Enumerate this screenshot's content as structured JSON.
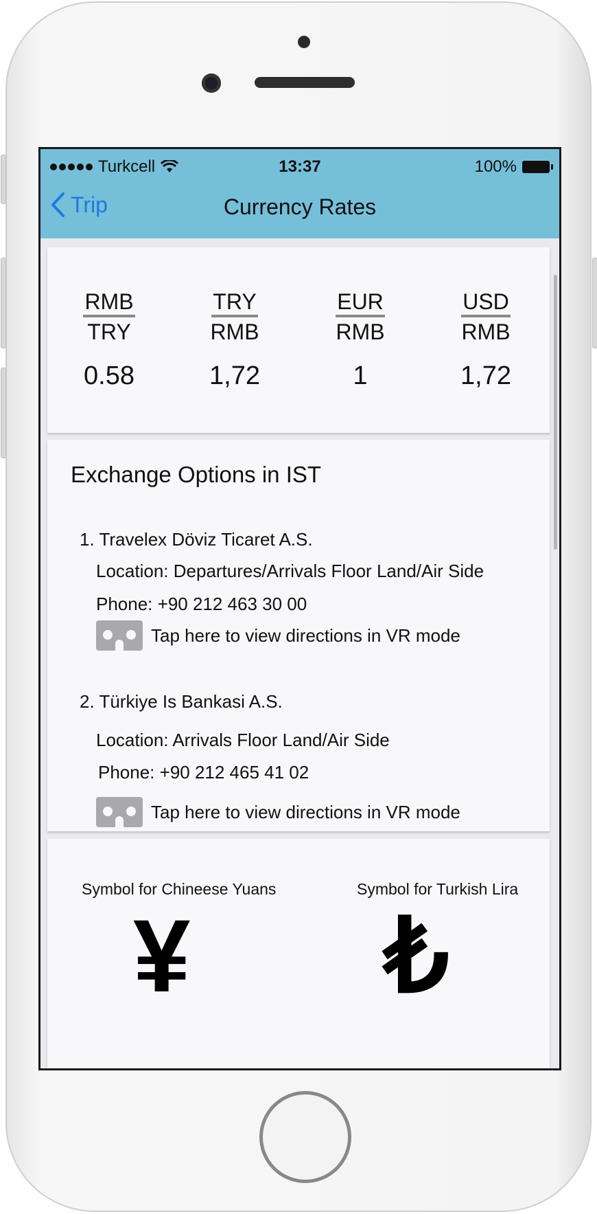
{
  "status": {
    "carrier": "Turkcell",
    "time": "13:37",
    "battery": "100%"
  },
  "nav": {
    "back_label": "Trip",
    "title": "Currency Rates"
  },
  "rates": [
    {
      "numerator": "RMB",
      "denominator": "TRY",
      "value": "0.58"
    },
    {
      "numerator": "TRY",
      "denominator": "RMB",
      "value": "1,72"
    },
    {
      "numerator": "EUR",
      "denominator": "RMB",
      "value": "1"
    },
    {
      "numerator": "USD",
      "denominator": "RMB",
      "value": "1,72"
    }
  ],
  "exchange": {
    "title": "Exchange Options in IST",
    "options": [
      {
        "name": "1. Travelex Döviz Ticaret A.S.",
        "location": "Location: Departures/Arrivals Floor Land/Air Side",
        "phone": "Phone: +90 212 463 30 00",
        "vr_label": "Tap here to view directions in VR mode"
      },
      {
        "name": "2. Türkiye Is Bankasi A.S.",
        "location": "Location: Arrivals Floor Land/Air Side",
        "phone": "Phone: +90 212 465 41 02",
        "vr_label": "Tap here to view directions in VR mode"
      }
    ]
  },
  "symbols": [
    {
      "label": "Symbol for Chineese Yuans",
      "glyph": "¥"
    },
    {
      "label": "Symbol for Turkish Lira",
      "glyph": "₺"
    }
  ],
  "colors": {
    "navbar": "#76bfd9",
    "link": "#1f7ae0"
  }
}
